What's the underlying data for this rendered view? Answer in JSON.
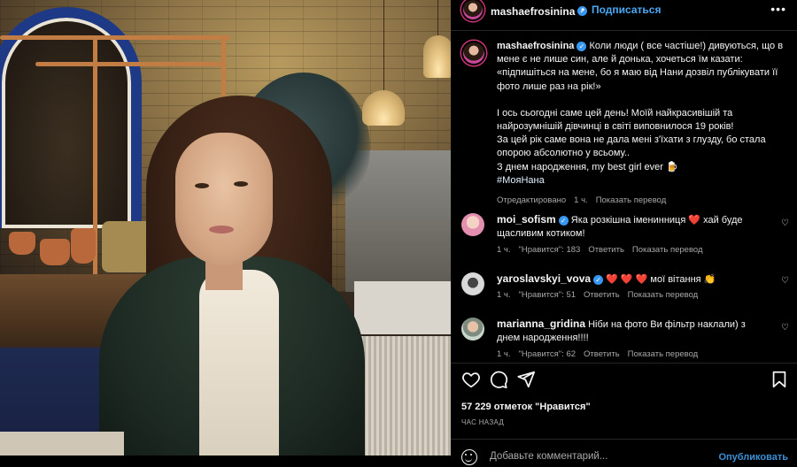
{
  "post": {
    "author": "mashaefrosinina",
    "follow_label": "Подписаться",
    "dot": "•",
    "more": "•••",
    "caption_lines": [
      "Коли люди ( все частіше!) дивуються, що в мене є не лише син, але й донька, хочеться їм казати:",
      "«підпишіться на мене, бо я маю від Нани дозвіл публікувати її фото лише раз на рік!»",
      "",
      "І ось сьогодні саме цей день! Моїй найкрасивішій та найрозумнішій дівчинці в світі виповнилося 19 років!",
      "За цей рік саме вона не дала мені з'їхати з глузду, бо стала опорою абсолютно у всьому..",
      "З днем народження, my best girl ever 🍺"
    ],
    "hashtag": "#МояНана",
    "caption_meta": {
      "edited": "Отредактировано",
      "time": "1 ч.",
      "translate": "Показать перевод"
    },
    "likes": "57 229 отметок \"Нравится\"",
    "posted": "ЧАС НАЗАД"
  },
  "comments": [
    {
      "user": "moi_sofism",
      "verified": true,
      "text": "Яка розкішна іменинниця ❤️ хай буде щасливим котиком!",
      "time": "1 ч.",
      "likes": "\"Нравится\": 183",
      "reply": "Ответить",
      "translate": "Показать перевод",
      "avatar_color": "#e58fb0"
    },
    {
      "user": "yaroslavskyi_vova",
      "verified": true,
      "text": "❤️ ❤️ ❤️ мої вітання 👏",
      "time": "1 ч.",
      "likes": "\"Нравится\": 51",
      "reply": "Ответить",
      "translate": "Показать перевод",
      "avatar_color": "#d9d9d9"
    },
    {
      "user": "marianna_gridina",
      "verified": false,
      "text": "Ніби на фото Ви фільтр наклали) з днем народження!!!!",
      "time": "1 ч.",
      "likes": "\"Нравится\": 62",
      "reply": "Ответить",
      "translate": "Показать перевод",
      "avatar_color": "#c9d6cc"
    }
  ],
  "composer": {
    "placeholder": "Добавьте комментарий...",
    "post_label": "Опубликовать"
  },
  "icons": {
    "like": "heart-icon",
    "comment": "comment-icon",
    "share": "paper-plane-icon",
    "save": "bookmark-icon",
    "emoji": "emoji-icon",
    "verified": "verified-badge-icon"
  },
  "colors": {
    "background": "#000000",
    "link_blue": "#4aa8f5",
    "verified_blue": "#3897f0",
    "secondary_text": "#a8a8a8",
    "divider": "#262626"
  }
}
